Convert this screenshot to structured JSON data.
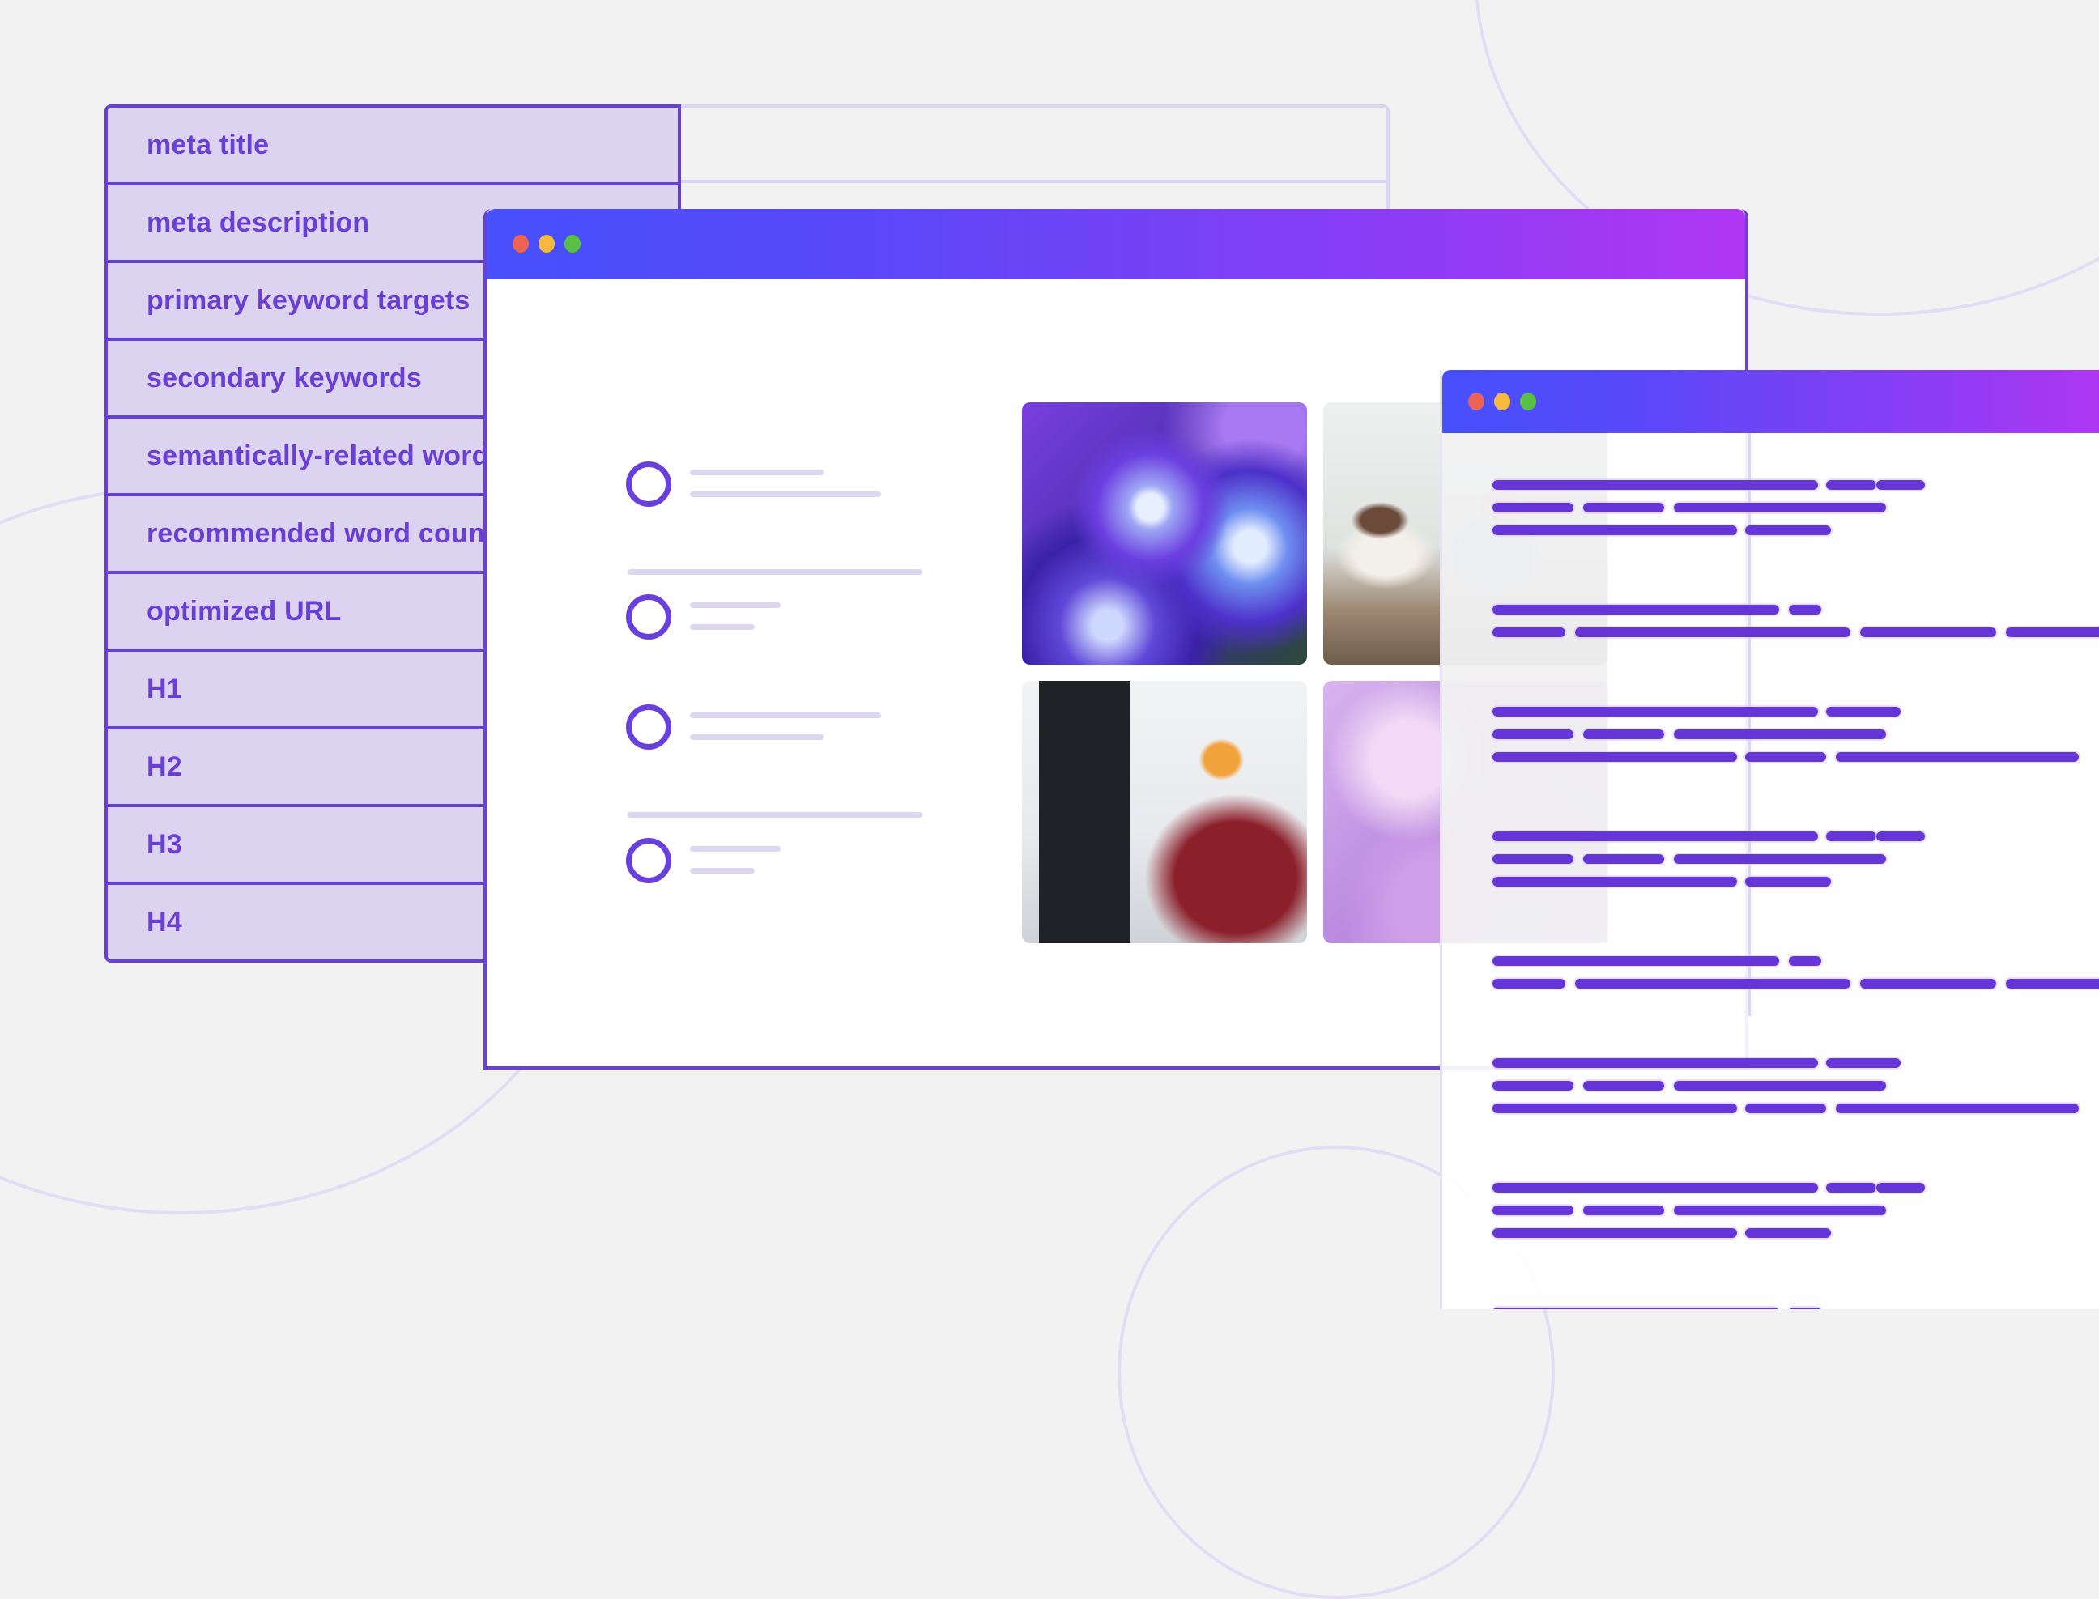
{
  "keyword_table": {
    "rows": [
      "meta title",
      "meta description",
      "primary keyword targets",
      "secondary keywords",
      "semantically-related words",
      "recommended word count",
      "optimized URL",
      "H1",
      "H2",
      "H3",
      "H4"
    ]
  },
  "main_window": {
    "controls": [
      "close",
      "minimize",
      "maximize"
    ],
    "list_items": 4,
    "images": [
      {
        "subject": "purple hydrangea flowers"
      },
      {
        "subject": "colleagues in a meeting"
      },
      {
        "subject": "developer with orange headphones at computer"
      },
      {
        "subject": "lilac smoke / flower texture"
      }
    ]
  },
  "document_window": {
    "controls": [
      "close",
      "minimize",
      "maximize"
    ]
  },
  "colors": {
    "accent": "#6a40dc",
    "table_fill": "#dcd3f0",
    "background": "#f2f2f2",
    "titlebar_start": "#4650fb",
    "titlebar_end": "#b036f3",
    "dot_red": "#ee6452",
    "dot_yellow": "#f6b940",
    "dot_green": "#58c045"
  }
}
